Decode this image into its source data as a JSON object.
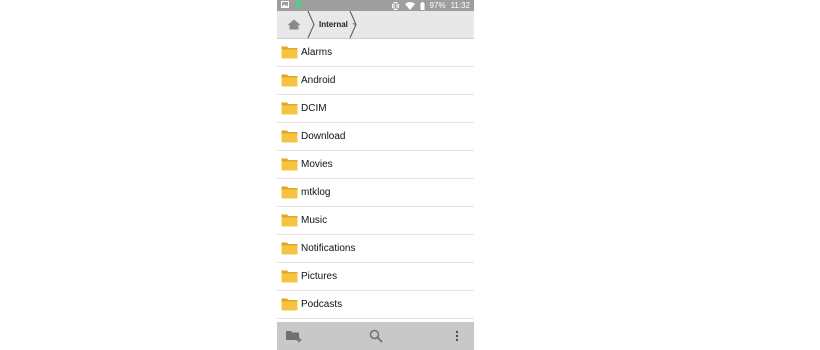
{
  "status_bar": {
    "battery_percent": "97%",
    "time": "11:32"
  },
  "breadcrumb": {
    "current": "Internal"
  },
  "folders": [
    {
      "name": "Alarms"
    },
    {
      "name": "Android"
    },
    {
      "name": "DCIM"
    },
    {
      "name": "Download"
    },
    {
      "name": "Movies"
    },
    {
      "name": "mtklog"
    },
    {
      "name": "Music"
    },
    {
      "name": "Notifications"
    },
    {
      "name": "Pictures"
    },
    {
      "name": "Podcasts"
    }
  ],
  "colors": {
    "status_bar": "#9e9e9e",
    "toolbar": "#e8e8e8",
    "bottom_bar": "#c8c8c8",
    "folder": "#f5c542",
    "folder_dark": "#e0a825"
  }
}
